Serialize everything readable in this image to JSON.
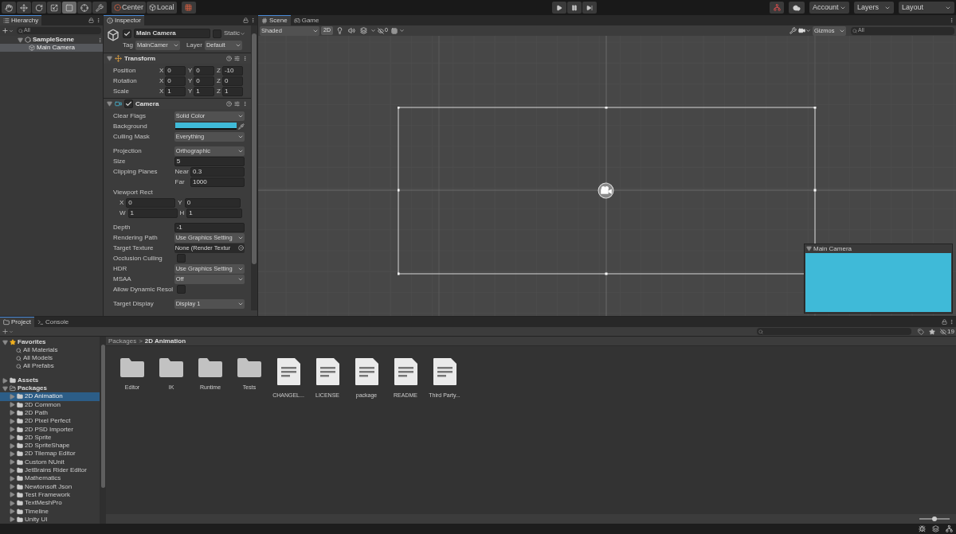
{
  "toolbar": {
    "tools": [
      {
        "kind": "hand",
        "selected": false
      },
      {
        "kind": "move",
        "selected": false
      },
      {
        "kind": "rotate",
        "selected": false
      },
      {
        "kind": "scale",
        "selected": false
      },
      {
        "kind": "rect",
        "selected": true
      },
      {
        "kind": "transform",
        "selected": false
      },
      {
        "kind": "custom",
        "selected": false
      }
    ],
    "pivot": [
      "Center",
      "Local"
    ],
    "play": [
      {
        "kind": "play"
      },
      {
        "kind": "pause"
      },
      {
        "kind": "step"
      }
    ],
    "menus": [
      "Account",
      "Layers",
      "Layout"
    ]
  },
  "hierarchy": {
    "title": "Hierarchy",
    "search_placeholder": "All",
    "tree": [
      {
        "label": "SampleScene",
        "kind": "scene",
        "selected": false,
        "children": [
          {
            "label": "Main Camera",
            "kind": "object",
            "selected": true
          }
        ]
      }
    ]
  },
  "inspector": {
    "title": "Inspector",
    "object_name": "Main Camera",
    "active": true,
    "static": {
      "label": "Static",
      "checked": false
    },
    "tag_label": "Tag",
    "tag": "MainCamer",
    "layer_label": "Layer",
    "layer": "Default",
    "components": [
      {
        "title": "Transform",
        "kind": "transform",
        "rows": [
          {
            "label": "Position",
            "fields": [
              {
                "axis": "X",
                "value": "0"
              },
              {
                "axis": "Y",
                "value": "0"
              },
              {
                "axis": "Z",
                "value": "-10"
              }
            ]
          },
          {
            "label": "Rotation",
            "fields": [
              {
                "axis": "X",
                "value": "0"
              },
              {
                "axis": "Y",
                "value": "0"
              },
              {
                "axis": "Z",
                "value": "0"
              }
            ]
          },
          {
            "label": "Scale",
            "fields": [
              {
                "axis": "X",
                "value": "1"
              },
              {
                "axis": "Y",
                "value": "1"
              },
              {
                "axis": "Z",
                "value": "1"
              }
            ]
          }
        ]
      },
      {
        "title": "Camera",
        "kind": "camera",
        "enabled": true,
        "props": [
          {
            "kind": "dropdown",
            "label": "Clear Flags",
            "value": "Solid Color"
          },
          {
            "kind": "color",
            "label": "Background",
            "color": "#3fbad8"
          },
          {
            "kind": "dropdown",
            "label": "Culling Mask",
            "value": "Everything"
          },
          {
            "kind": "gap"
          },
          {
            "kind": "dropdown",
            "label": "Projection",
            "value": "Orthographic"
          },
          {
            "kind": "text",
            "label": "Size",
            "value": "5"
          },
          {
            "kind": "sub",
            "label": "Clipping Planes",
            "sublabel": "Near",
            "value": "0.3"
          },
          {
            "kind": "sub",
            "sublabel": "Far",
            "value": "1000"
          },
          {
            "kind": "header",
            "label": "Viewport Rect"
          },
          {
            "kind": "pair",
            "a_label": "X",
            "a": "0",
            "b_label": "Y",
            "b": "0"
          },
          {
            "kind": "pair",
            "a_label": "W",
            "a": "1",
            "b_label": "H",
            "b": "1"
          },
          {
            "kind": "gap"
          },
          {
            "kind": "text",
            "label": "Depth",
            "value": "-1"
          },
          {
            "kind": "dropdown",
            "label": "Rendering Path",
            "value": "Use Graphics Setting"
          },
          {
            "kind": "object",
            "label": "Target Texture",
            "value": "None (Render Textur"
          },
          {
            "kind": "checkbox",
            "label": "Occlusion Culling",
            "checked": false
          },
          {
            "kind": "dropdown",
            "label": "HDR",
            "value": "Use Graphics Setting"
          },
          {
            "kind": "dropdown",
            "label": "MSAA",
            "value": "Off"
          },
          {
            "kind": "checkbox",
            "label": "Allow Dynamic Resol",
            "checked": false
          },
          {
            "kind": "gap"
          },
          {
            "kind": "dropdown",
            "label": "Target Display",
            "value": "Display 1"
          }
        ]
      }
    ]
  },
  "scene": {
    "tabs": [
      {
        "label": "Scene",
        "kind": "scene",
        "selected": true
      },
      {
        "label": "Game",
        "kind": "game",
        "selected": false
      }
    ],
    "shading": "Shaded",
    "mode_2d": {
      "label": "2D",
      "on": true
    },
    "hidden_count": "0",
    "gizmos": "Gizmos",
    "search_placeholder": "All",
    "preview": {
      "title": "Main Camera",
      "color": "#3fbad8"
    }
  },
  "project": {
    "tabs": [
      {
        "label": "Project",
        "kind": "project",
        "selected": true
      },
      {
        "label": "Console",
        "kind": "console",
        "selected": false
      }
    ],
    "favorites": {
      "label": "Favorites",
      "items": [
        "All Materials",
        "All Models",
        "All Prefabs"
      ]
    },
    "roots": [
      {
        "label": "Assets",
        "expanded": false
      },
      {
        "label": "Packages",
        "expanded": true,
        "children": [
          {
            "label": "2D Animation",
            "selected": true
          },
          {
            "label": "2D Common",
            "selected": false
          },
          {
            "label": "2D Path",
            "selected": false
          },
          {
            "label": "2D Pixel Perfect",
            "selected": false
          },
          {
            "label": "2D PSD Importer",
            "selected": false
          },
          {
            "label": "2D Sprite",
            "selected": false
          },
          {
            "label": "2D SpriteShape",
            "selected": false
          },
          {
            "label": "2D Tilemap Editor",
            "selected": false
          },
          {
            "label": "Custom NUnit",
            "selected": false
          },
          {
            "label": "JetBrains Rider Editor",
            "selected": false
          },
          {
            "label": "Mathematics",
            "selected": false
          },
          {
            "label": "Newtonsoft Json",
            "selected": false
          },
          {
            "label": "Test Framework",
            "selected": false
          },
          {
            "label": "TextMeshPro",
            "selected": false
          },
          {
            "label": "Timeline",
            "selected": false
          },
          {
            "label": "Unity UI",
            "selected": false
          }
        ]
      }
    ],
    "breadcrumb": [
      "Packages",
      "2D Animation"
    ],
    "breadcrumb_separator": ">",
    "assets": [
      {
        "name": "Editor",
        "kind": "folder"
      },
      {
        "name": "IK",
        "kind": "folder"
      },
      {
        "name": "Runtime",
        "kind": "folder"
      },
      {
        "name": "Tests",
        "kind": "folder"
      },
      {
        "name": "CHANGEL...",
        "kind": "file"
      },
      {
        "name": "LICENSE",
        "kind": "file"
      },
      {
        "name": "package",
        "kind": "file"
      },
      {
        "name": "README",
        "kind": "file"
      },
      {
        "name": "Third Party...",
        "kind": "file"
      }
    ],
    "hidden_packages": "19",
    "zoom": {
      "level": 0.5
    }
  }
}
